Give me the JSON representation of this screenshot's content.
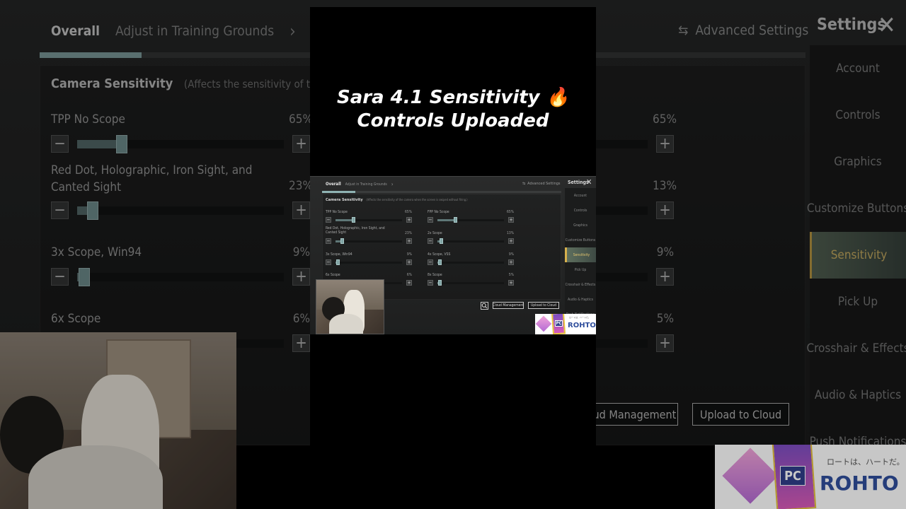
{
  "settings": {
    "tab_overall": "Overall",
    "tab_training": "Adjust in Training Grounds",
    "tab_chevron": "›",
    "advanced_icon": "⇆",
    "advanced": "Advanced Settings",
    "title": "Settings",
    "close": "✕",
    "section_title": "Camera Sensitivity",
    "section_note_big": "(Affects the sensitivity of the camera w",
    "section_note_small": "(Affects the sensitivity of the camera when the screen is swiped without firing.)",
    "sidebar": [
      {
        "label": "Account",
        "active": false
      },
      {
        "label": "Controls",
        "active": false
      },
      {
        "label": "Graphics",
        "active": false
      },
      {
        "label": "Customize Buttons",
        "active": false
      },
      {
        "label": "Sensitivity",
        "active": true
      },
      {
        "label": "Pick Up",
        "active": false
      },
      {
        "label": "Crosshair & Effects",
        "active": false
      },
      {
        "label": "Audio & Haptics",
        "active": false
      },
      {
        "label": "Push Notifications",
        "active": false
      }
    ],
    "rows_left": [
      {
        "label": "TPP No Scope",
        "pct": "65%",
        "value": 0.65
      },
      {
        "label": "Red Dot, Holographic, Iron Sight, and Canted Sight",
        "pct": "23%",
        "value": 0.23
      },
      {
        "label": "3x Scope, Win94",
        "pct": "9%",
        "value": 0.09
      },
      {
        "label": "6x Scope",
        "pct": "6%",
        "value": 0.06
      }
    ],
    "rows_right": [
      {
        "label": "FPP No Scope",
        "pct": "65%",
        "value": 0.65
      },
      {
        "label": "2x Scope",
        "pct": "13%",
        "value": 0.13
      },
      {
        "label": "4x Scope, VSS",
        "pct": "9%",
        "value": 0.09
      },
      {
        "label": "8x Scope",
        "pct": "5%",
        "value": 0.05
      }
    ],
    "minus": "−",
    "plus": "+",
    "cloud_management": "Cloud Management",
    "cloud_management_big": "loud Management",
    "upload_to_cloud": "Upload to Cloud"
  },
  "caption": {
    "line1": "Sara 4.1 Sensitivity 🔥",
    "line2": "Controls Uploaded"
  },
  "ad": {
    "box_label": "PC",
    "tagline": "ロートは、ハートだ。",
    "brand": "ROHTO"
  }
}
